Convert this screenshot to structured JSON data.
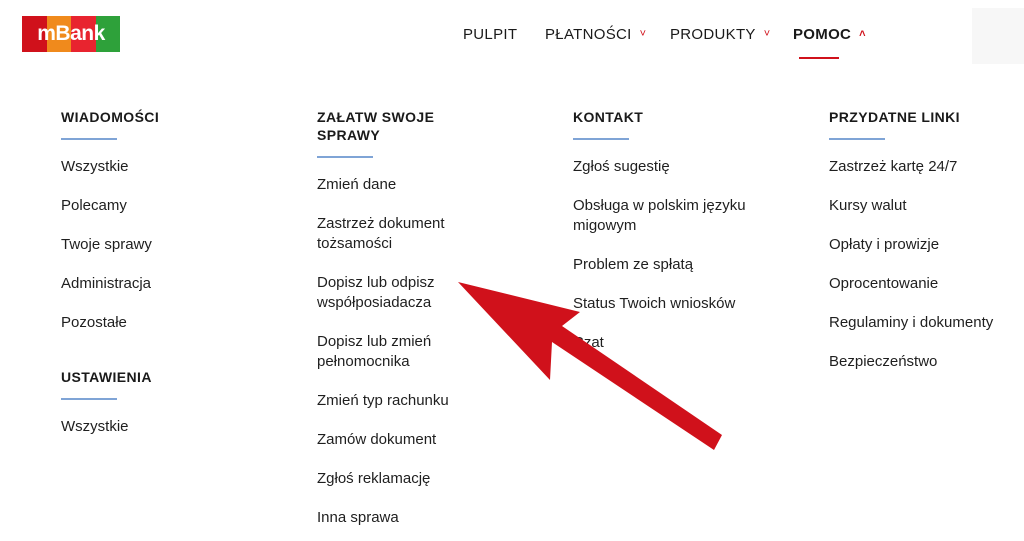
{
  "brand": {
    "name": "mBank",
    "stripe_colors": [
      "#d0111b",
      "#f08a1c",
      "#e8242f",
      "#2ea13a"
    ]
  },
  "nav": {
    "items": [
      {
        "label": "PULPIT",
        "has_chevron": false
      },
      {
        "label": "PŁATNOŚCI",
        "has_chevron": true,
        "chevron": "˅"
      },
      {
        "label": "PRODUKTY",
        "has_chevron": true,
        "chevron": "˅"
      },
      {
        "label": "POMOC",
        "has_chevron": true,
        "chevron": "˄",
        "active": true
      }
    ],
    "accent_color": "#d0111b"
  },
  "menu": {
    "wiadomosci": {
      "title": "WIADOMOŚCI",
      "items": [
        "Wszystkie",
        "Polecamy",
        "Twoje sprawy",
        "Administracja",
        "Pozostałe"
      ]
    },
    "ustawienia": {
      "title": "USTAWIENIA",
      "items": [
        "Wszystkie"
      ]
    },
    "zalatw": {
      "title": "ZAŁATW SWOJE SPRAWY",
      "items": [
        "Zmień dane",
        "Zastrzeż dokument tożsamości",
        "Dopisz lub odpisz współposiadacza",
        "Dopisz lub zmień pełnomocnika",
        "Zmień typ rachunku",
        "Zamów dokument",
        "Zgłoś reklamację",
        "Inna sprawa"
      ]
    },
    "kontakt": {
      "title": "KONTAKT",
      "items": [
        "Zgłoś sugestię",
        "Obsługa w polskim języku migowym",
        "Problem ze spłatą",
        "Status Twoich wniosków",
        "Czat"
      ]
    },
    "linki": {
      "title": "PRZYDATNE LINKI",
      "items": [
        "Zastrzeż kartę 24/7",
        "Kursy walut",
        "Opłaty i prowizje",
        "Oprocentowanie",
        "Regulaminy i dokumenty",
        "Bezpieczeństwo"
      ]
    },
    "rule_color": "#7fa4d6"
  },
  "annotation": {
    "arrow_color": "#d0111b",
    "points_to": "Dopisz lub odpisz współposiadacza"
  }
}
